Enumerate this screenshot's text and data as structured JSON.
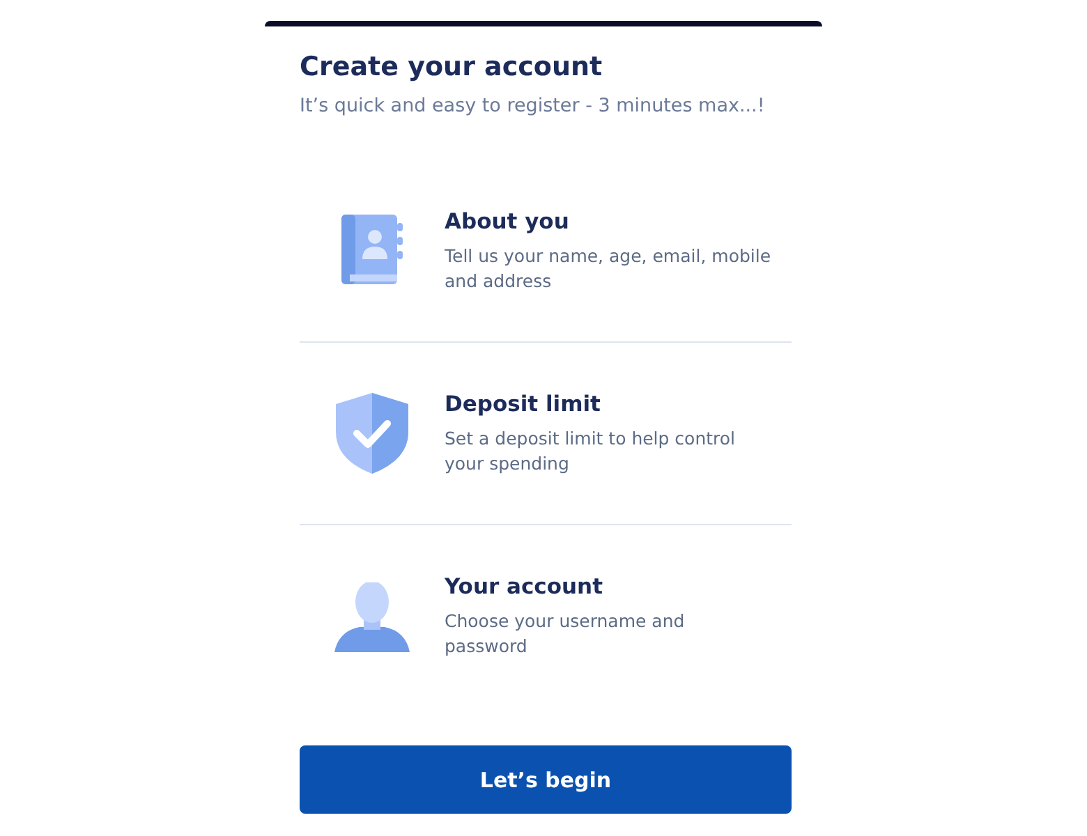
{
  "title": "Create your account",
  "subtitle": "It’s quick and easy to register - 3 minutes max...!",
  "steps": [
    {
      "kind": "book",
      "title": "About you",
      "description": "Tell us your name, age, email, mobile and address"
    },
    {
      "kind": "shield",
      "title": "Deposit limit",
      "description": "Set a deposit limit to help control your spending"
    },
    {
      "kind": "person",
      "title": "Your account",
      "description": "Choose your username and password"
    }
  ],
  "button": "Let’s begin"
}
